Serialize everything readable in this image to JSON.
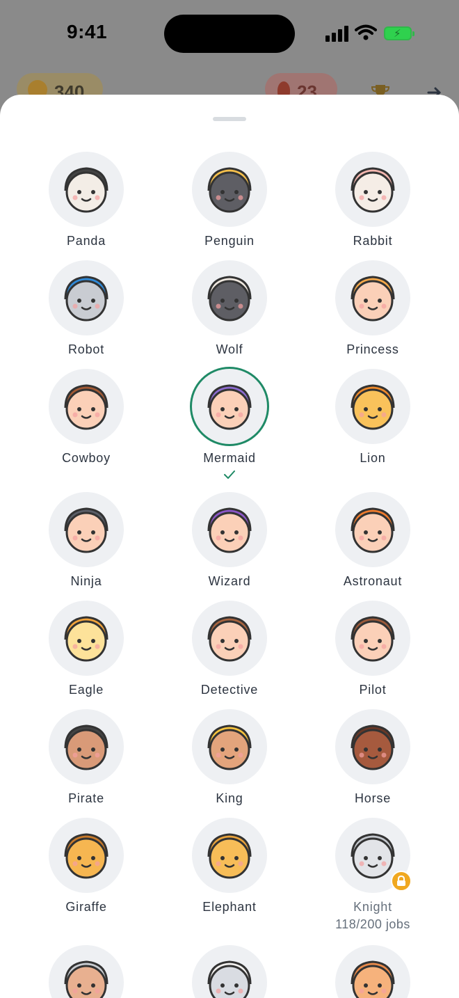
{
  "status_bar": {
    "time": "9:41"
  },
  "top_bar": {
    "coins": "340",
    "streak": "23"
  },
  "avatars": [
    {
      "id": "panda",
      "name": "Panda",
      "c": "#f3ede6",
      "a": "#444"
    },
    {
      "id": "penguin",
      "name": "Penguin",
      "c": "#5e5e64",
      "a": "#f6c04c"
    },
    {
      "id": "rabbit",
      "name": "Rabbit",
      "c": "#f5ede6",
      "a": "#f4b7b0"
    },
    {
      "id": "robot",
      "name": "Robot",
      "c": "#c9ccd2",
      "a": "#2f8ad9"
    },
    {
      "id": "wolf",
      "name": "Wolf",
      "c": "#5e5e64",
      "a": "#efe8e0"
    },
    {
      "id": "princess",
      "name": "Princess",
      "c": "#fbd0b8",
      "a": "#f6a94a"
    },
    {
      "id": "cowboy",
      "name": "Cowboy",
      "c": "#fbd0b8",
      "a": "#a35a34"
    },
    {
      "id": "mermaid",
      "name": "Mermaid",
      "c": "#fbd0b8",
      "a": "#8c6bd0",
      "selected": true
    },
    {
      "id": "lion",
      "name": "Lion",
      "c": "#f9c25b",
      "a": "#f08a2a"
    },
    {
      "id": "ninja",
      "name": "Ninja",
      "c": "#fbd0b8",
      "a": "#5b5f68"
    },
    {
      "id": "wizard",
      "name": "Wizard",
      "c": "#fbd0b8",
      "a": "#8b56c8"
    },
    {
      "id": "astronaut",
      "name": "Astronaut",
      "c": "#fbd0b8",
      "a": "#f07b2c"
    },
    {
      "id": "eagle",
      "name": "Eagle",
      "c": "#fde29a",
      "a": "#f2a33a"
    },
    {
      "id": "detective",
      "name": "Detective",
      "c": "#fbd0b8",
      "a": "#a8643f"
    },
    {
      "id": "pilot",
      "name": "Pilot",
      "c": "#fbd0b8",
      "a": "#9c5a3a"
    },
    {
      "id": "pirate",
      "name": "Pirate",
      "c": "#d99a78",
      "a": "#444"
    },
    {
      "id": "king",
      "name": "King",
      "c": "#e3a47c",
      "a": "#f6c33d"
    },
    {
      "id": "horse",
      "name": "Horse",
      "c": "#a65a3e",
      "a": "#6a3826"
    },
    {
      "id": "giraffe",
      "name": "Giraffe",
      "c": "#f6b651",
      "a": "#c97a2a"
    },
    {
      "id": "elephant",
      "name": "Elephant",
      "c": "#f7bd58",
      "a": "#e9a33c"
    },
    {
      "id": "knight",
      "name": "Knight",
      "c": "#e2e4e8",
      "a": "#c4c8ce",
      "locked": true,
      "progress": "118/200 jobs"
    },
    {
      "id": "viking",
      "name": "",
      "c": "#e8b090",
      "a": "#c9cdd2"
    },
    {
      "id": "koala",
      "name": "",
      "c": "#d9dce2",
      "a": "#f3f1ef"
    },
    {
      "id": "tiger",
      "name": "",
      "c": "#f6b27c",
      "a": "#e98a4a"
    }
  ]
}
